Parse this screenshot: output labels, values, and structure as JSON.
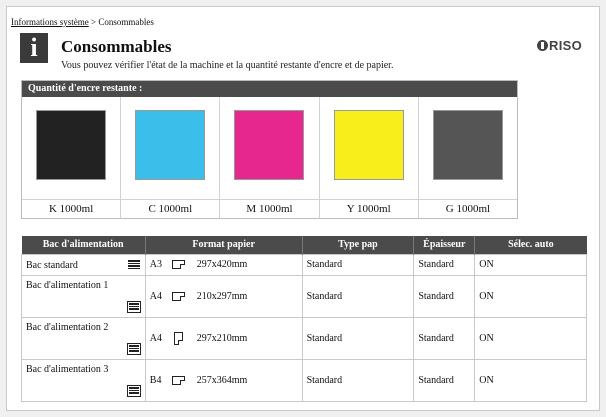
{
  "breadcrumb": {
    "parent": "Informations système",
    "separator": " > ",
    "current": "Consommables"
  },
  "header": {
    "title": "Consommables",
    "subtitle": "Vous pouvez vérifier l'état de la machine et la quantité restante d'encre et de papier.",
    "logo_text": "RISO"
  },
  "ink": {
    "heading": "Quantité d'encre restante :",
    "items": [
      {
        "label": "K 1000ml",
        "color": "#222222"
      },
      {
        "label": "C 1000ml",
        "color": "#3bbfea"
      },
      {
        "label": "M 1000ml",
        "color": "#e6288e"
      },
      {
        "label": "Y 1000ml",
        "color": "#f7ee1c"
      },
      {
        "label": "G  1000ml",
        "color": "#555555"
      }
    ]
  },
  "trays": {
    "columns": [
      "Bac d'alimentation",
      "Format papier",
      "Type pap",
      "Épaisseur",
      "Sélec. auto"
    ],
    "rows": [
      {
        "name": "Bac standard",
        "size": "A3",
        "orientation": "landscape",
        "dims": "297x420mm",
        "type": "Standard",
        "thickness": "Standard",
        "auto": "ON"
      },
      {
        "name": "Bac d'alimentation 1",
        "size": "A4",
        "orientation": "landscape",
        "dims": "210x297mm",
        "type": "Standard",
        "thickness": "Standard",
        "auto": "ON"
      },
      {
        "name": "Bac d'alimentation 2",
        "size": "A4",
        "orientation": "portrait",
        "dims": "297x210mm",
        "type": "Standard",
        "thickness": "Standard",
        "auto": "ON"
      },
      {
        "name": "Bac d'alimentation 3",
        "size": "B4",
        "orientation": "landscape",
        "dims": "257x364mm",
        "type": "Standard",
        "thickness": "Standard",
        "auto": "ON"
      }
    ]
  }
}
